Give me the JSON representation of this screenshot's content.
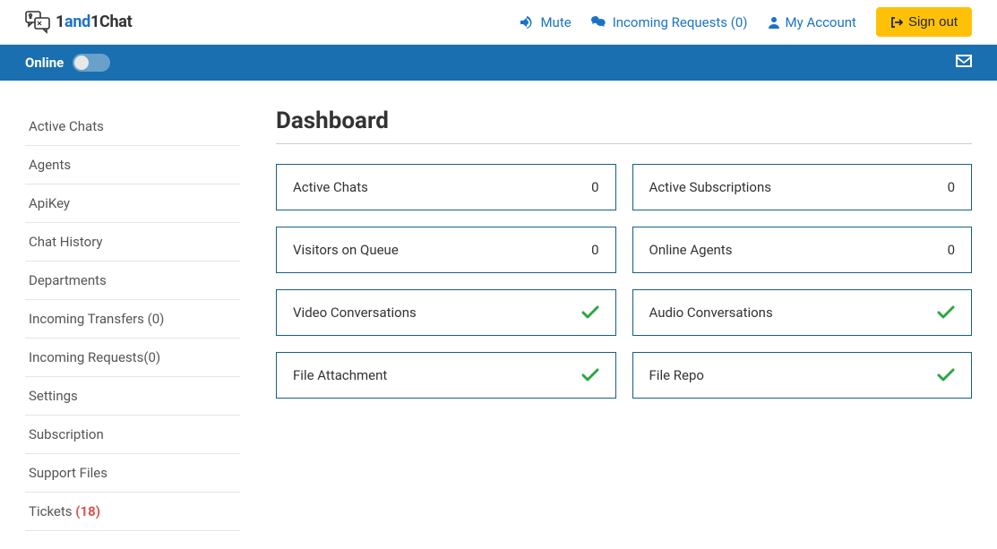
{
  "brand": {
    "name1": "1",
    "and": "and",
    "name2": "1Chat"
  },
  "nav": {
    "mute": "Mute",
    "incoming": "Incoming Requests (0)",
    "account": "My Account",
    "signout": "Sign out"
  },
  "status": {
    "label": "Online"
  },
  "sidebar": {
    "items": [
      {
        "label": "Active Chats"
      },
      {
        "label": "Agents"
      },
      {
        "label": "ApiKey"
      },
      {
        "label": "Chat History"
      },
      {
        "label": "Departments"
      },
      {
        "label": "Incoming Transfers (0)"
      },
      {
        "label": "Incoming Requests(0)"
      },
      {
        "label": "Settings"
      },
      {
        "label": "Subscription"
      },
      {
        "label": "Support Files"
      }
    ],
    "tickets_label": "Tickets",
    "tickets_count": "(18)"
  },
  "page": {
    "title": "Dashboard"
  },
  "cards": [
    {
      "label": "Active Chats",
      "value": "0",
      "type": "number"
    },
    {
      "label": "Active Subscriptions",
      "value": "0",
      "type": "number"
    },
    {
      "label": "Visitors on Queue",
      "value": "0",
      "type": "number"
    },
    {
      "label": "Online Agents",
      "value": "0",
      "type": "number"
    },
    {
      "label": "Video Conversations",
      "type": "check"
    },
    {
      "label": "Audio Conversations",
      "type": "check"
    },
    {
      "label": "File Attachment",
      "type": "check"
    },
    {
      "label": "File Repo",
      "type": "check"
    }
  ]
}
